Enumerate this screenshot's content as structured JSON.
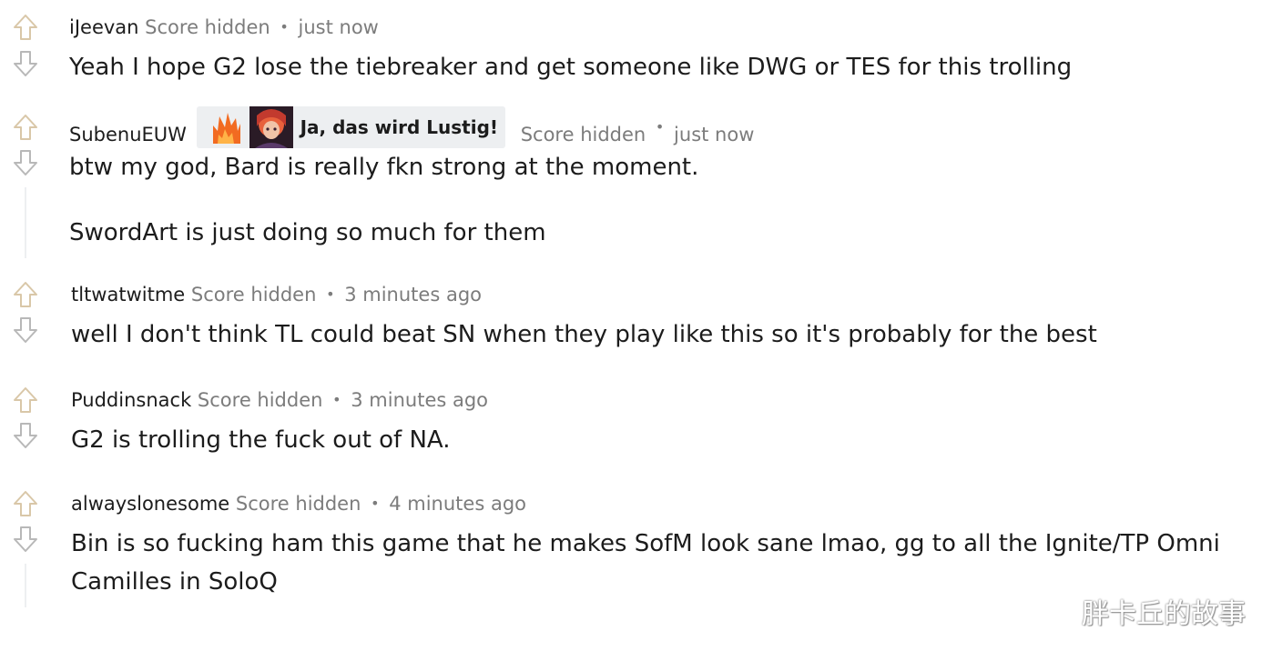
{
  "comments": [
    {
      "author": "iJeevan",
      "score": "Score hidden",
      "time": "just now",
      "body": [
        "Yeah I hope G2 lose the tiebreaker and get someone like DWG or TES for this trolling"
      ]
    },
    {
      "author": "SubenuEUW",
      "flair": {
        "text": "Ja, das wird Lustig!",
        "emojis": [
          "flame-flair-emoji",
          "champion-portrait-flair-emoji"
        ]
      },
      "score": "Score hidden",
      "time": "just now",
      "body": [
        "btw my god, Bard is really fkn strong at the moment.",
        "SwordArt is just doing so much for them"
      ]
    },
    {
      "author": "tltwatwitme",
      "score": "Score hidden",
      "time": "3 minutes ago",
      "body": [
        "well I don't think TL could beat SN when they play like this so it's probably for the best"
      ]
    },
    {
      "author": "Puddinsnack",
      "score": "Score hidden",
      "time": "3 minutes ago",
      "body": [
        "G2 is trolling the fuck out of NA."
      ]
    },
    {
      "author": "alwayslonesome",
      "score": "Score hidden",
      "time": "4 minutes ago",
      "body": [
        "Bin is so fucking ham this game that he makes SofM look sane lmao, gg to all the Ignite/TP Omni",
        "Camilles in SoloQ"
      ]
    }
  ],
  "separator": "•",
  "icons": {
    "upvote": "arrow-up-outline-icon",
    "downvote": "arrow-down-outline-icon"
  },
  "colors": {
    "upvote_stroke": "#d9c7a8",
    "downvote_stroke": "#b8b8b8",
    "meta_text": "#7c7c7c",
    "body_text": "#1c1c1c",
    "flair_bg": "#edeff1"
  },
  "watermark": "胖卡丘的故事"
}
